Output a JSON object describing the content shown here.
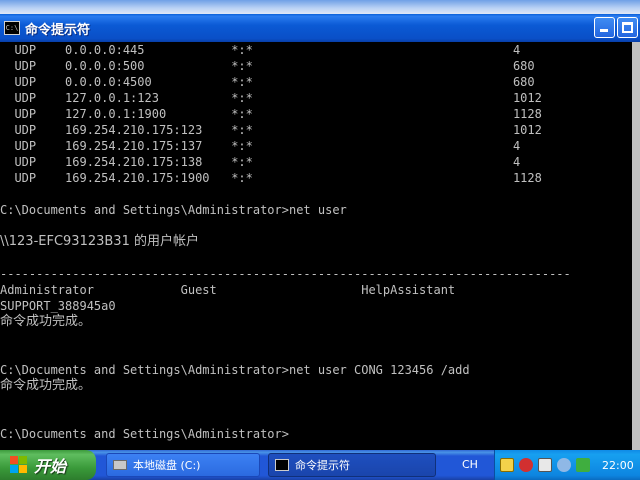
{
  "window": {
    "title": "命令提示符",
    "icon_text": "C:\\"
  },
  "console": {
    "lines": [
      "  UDP    0.0.0.0:445            *:*                                    4",
      "  UDP    0.0.0.0:500            *:*                                    680",
      "  UDP    0.0.0.0:4500           *:*                                    680",
      "  UDP    127.0.0.1:123          *:*                                    1012",
      "  UDP    127.0.0.1:1900         *:*                                    1128",
      "  UDP    169.254.210.175:123    *:*                                    1012",
      "  UDP    169.254.210.175:137    *:*                                    4",
      "  UDP    169.254.210.175:138    *:*                                    4",
      "  UDP    169.254.210.175:1900   *:*                                    1128",
      "",
      "C:\\Documents and Settings\\Administrator>net user",
      "",
      "\\\\123-EFC93123B31 的用户帐户",
      "",
      "-------------------------------------------------------------------------------",
      "Administrator            Guest                    HelpAssistant",
      "SUPPORT_388945a0",
      "命令成功完成。",
      "",
      "",
      "C:\\Documents and Settings\\Administrator>net user CONG 123456 /add",
      "命令成功完成。",
      "",
      "",
      "C:\\Documents and Settings\\Administrator>"
    ]
  },
  "taskbar": {
    "start_label": "开始",
    "tasks": [
      {
        "label": "本地磁盘 (C:)"
      },
      {
        "label": "命令提示符"
      }
    ],
    "language": "CH",
    "clock": "22:00"
  }
}
